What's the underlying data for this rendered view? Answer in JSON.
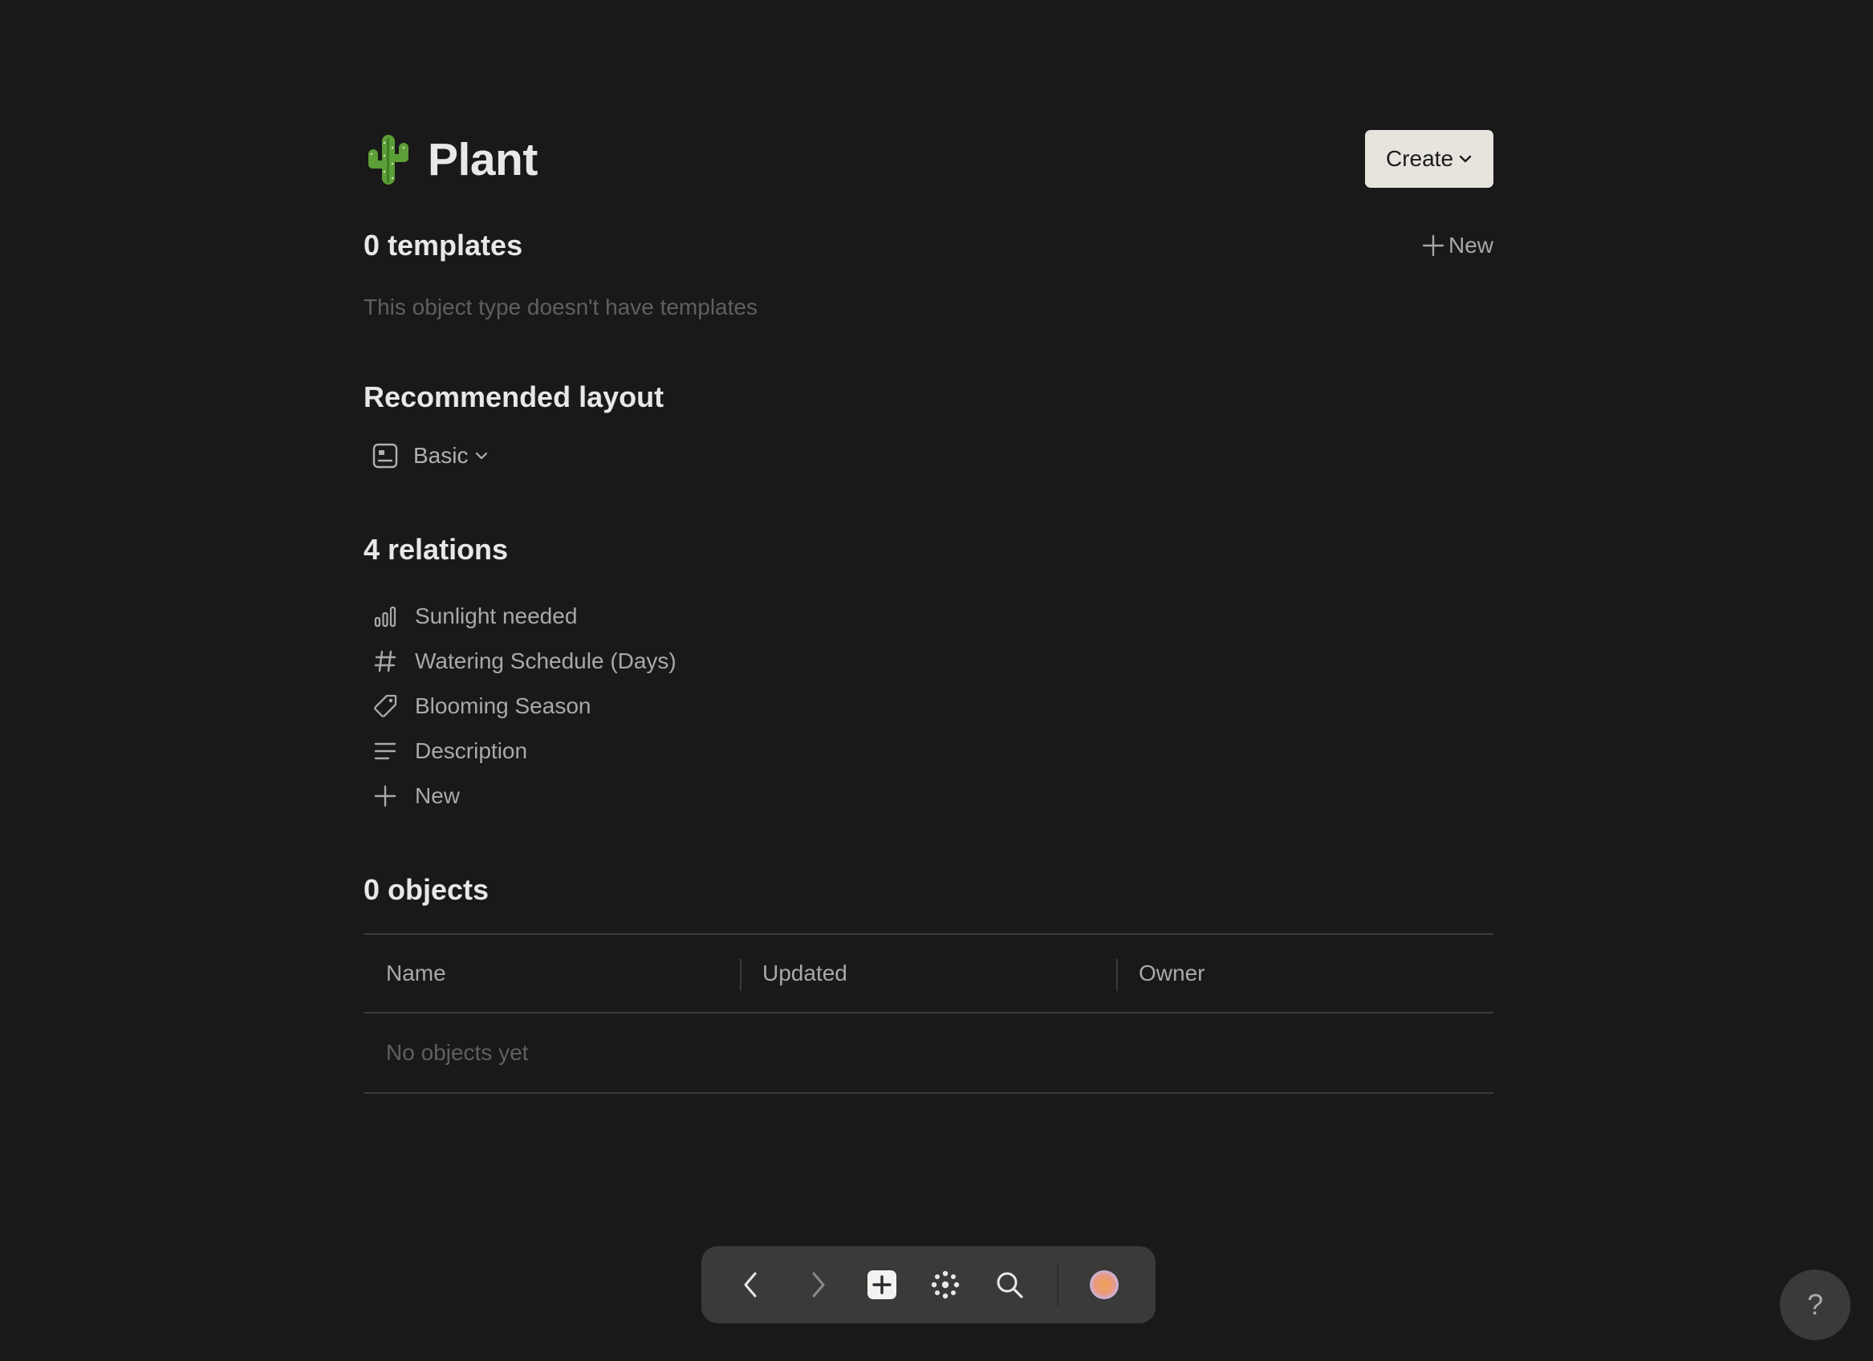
{
  "header": {
    "title": "Plant",
    "icon": "cactus-emoji",
    "create_label": "Create"
  },
  "templates": {
    "title": "0 templates",
    "new_label": "New",
    "empty_text": "This object type doesn't have templates"
  },
  "layout": {
    "title": "Recommended layout",
    "selected": "Basic"
  },
  "relations": {
    "title": "4 relations",
    "items": [
      {
        "label": "Sunlight needed",
        "icon": "bar-chart-icon"
      },
      {
        "label": "Watering Schedule (Days)",
        "icon": "hash-icon"
      },
      {
        "label": "Blooming Season",
        "icon": "tag-icon"
      },
      {
        "label": "Description",
        "icon": "text-lines-icon"
      }
    ],
    "new_label": "New"
  },
  "objects": {
    "title": "0 objects",
    "columns": [
      "Name",
      "Updated",
      "Owner"
    ],
    "empty_text": "No objects yet"
  },
  "navbar": {
    "items": [
      "back-icon",
      "forward-icon",
      "plus-icon",
      "graph-icon",
      "search-icon",
      "profile-icon"
    ]
  },
  "help": {
    "label": "?"
  },
  "colors": {
    "background": "#191919",
    "create_button": "#e6e4dc",
    "navbar": "#3a3a39"
  }
}
